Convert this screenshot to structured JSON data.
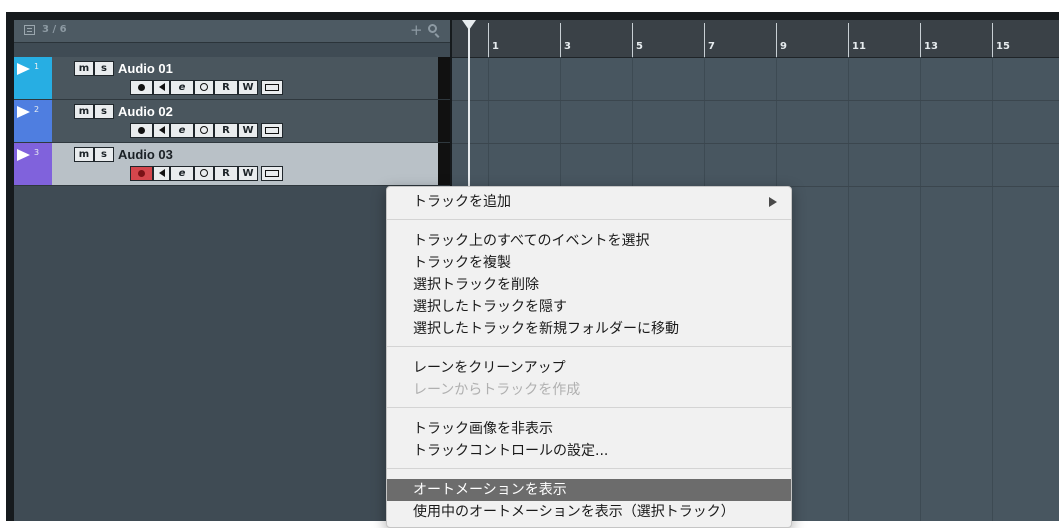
{
  "tracklist": {
    "count": "3 / 6",
    "add_symbol": "+",
    "tracks": [
      {
        "number": "1",
        "name": "Audio 01",
        "mute": "m",
        "solo": "s",
        "read": "R",
        "write": "W",
        "color": "#27aee3",
        "selected": false,
        "rec_armed": false
      },
      {
        "number": "2",
        "name": "Audio 02",
        "mute": "m",
        "solo": "s",
        "read": "R",
        "write": "W",
        "color": "#4f7ee0",
        "selected": false,
        "rec_armed": false
      },
      {
        "number": "3",
        "name": "Audio 03",
        "mute": "m",
        "solo": "s",
        "read": "R",
        "write": "W",
        "color": "#8062dc",
        "selected": true,
        "rec_armed": true
      }
    ]
  },
  "ruler": {
    "labels": [
      "1",
      "3",
      "5",
      "7",
      "9",
      "11",
      "13",
      "15"
    ]
  },
  "context_menu": {
    "groups": [
      [
        {
          "label": "トラックを追加",
          "submenu": true
        }
      ],
      [
        {
          "label": "トラック上のすべてのイベントを選択"
        },
        {
          "label": "トラックを複製"
        },
        {
          "label": "選択トラックを削除"
        },
        {
          "label": "選択したトラックを隠す"
        },
        {
          "label": "選択したトラックを新規フォルダーに移動"
        }
      ],
      [
        {
          "label": "レーンをクリーンアップ"
        },
        {
          "label": "レーンからトラックを作成",
          "disabled": true
        }
      ],
      [
        {
          "label": "トラック画像を非表示"
        },
        {
          "label": "トラックコントロールの設定..."
        }
      ],
      [
        {
          "label": "オートメーションを表示",
          "highlighted": true
        },
        {
          "label": "使用中のオートメーションを表示（選択トラック）"
        }
      ]
    ]
  }
}
